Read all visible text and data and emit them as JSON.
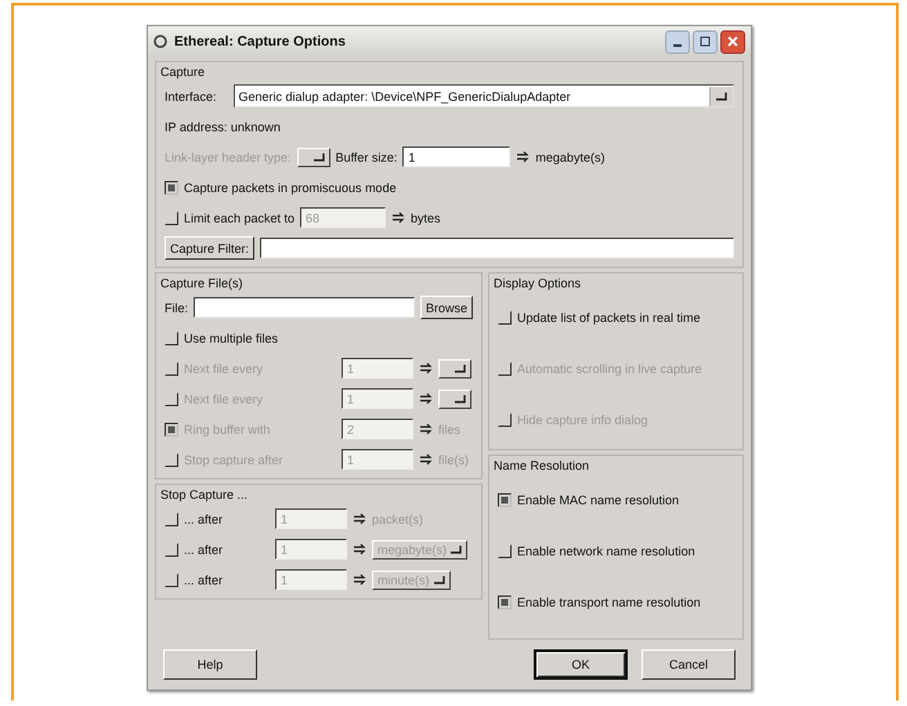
{
  "window": {
    "title": "Ethereal: Capture Options"
  },
  "capture": {
    "title": "Capture",
    "interface_label": "Interface:",
    "interface_value": "Generic dialup adapter: \\Device\\NPF_GenericDialupAdapter",
    "ip_address": "IP address: unknown",
    "link_layer_label": "Link-layer header type:",
    "link_layer_disabled": true,
    "buffer_label": "Buffer size:",
    "buffer_value": "1",
    "buffer_unit": "megabyte(s)",
    "promiscuous": {
      "label": "Capture packets in promiscuous mode",
      "checked": true
    },
    "limit": {
      "label": "Limit each packet to",
      "checked": false,
      "value": "68",
      "value_disabled": true,
      "unit": "bytes"
    },
    "filter_button": "Capture Filter:"
  },
  "capture_files": {
    "title": "Capture File(s)",
    "file_label": "File:",
    "browse_button": "Browse",
    "multiple_files": {
      "label": "Use multiple files",
      "checked": false
    },
    "rows": [
      {
        "kind": "dropdown",
        "label": "Next file every",
        "checked": false,
        "disabled": true,
        "value": "1"
      },
      {
        "kind": "dropdown",
        "label": "Next file every",
        "checked": false,
        "disabled": true,
        "value": "1"
      },
      {
        "kind": "unit",
        "label": "Ring buffer with",
        "checked": true,
        "disabled": true,
        "value": "2",
        "unit": "files"
      },
      {
        "kind": "unit",
        "label": "Stop capture after",
        "checked": false,
        "disabled": true,
        "value": "1",
        "unit": "file(s)"
      }
    ]
  },
  "stop_capture": {
    "title": "Stop Capture ...",
    "rows": [
      {
        "kind": "unit",
        "label": "... after",
        "checked": false,
        "field_disabled": true,
        "value": "1",
        "unit": "packet(s)"
      },
      {
        "kind": "dropdown",
        "label": "... after",
        "checked": false,
        "field_disabled": true,
        "value": "1",
        "option": "megabyte(s)"
      },
      {
        "kind": "dropdown",
        "label": "... after",
        "checked": false,
        "field_disabled": true,
        "value": "1",
        "option": "minute(s)"
      }
    ]
  },
  "display_options": {
    "title": "Display Options",
    "items": [
      {
        "label": "Update list of packets in real time",
        "checked": false,
        "disabled": false
      },
      {
        "label": "Automatic scrolling in live capture",
        "checked": false,
        "disabled": true
      },
      {
        "label": "Hide capture info dialog",
        "checked": false,
        "disabled": true
      }
    ]
  },
  "name_resolution": {
    "title": "Name Resolution",
    "items": [
      {
        "label": "Enable MAC name resolution",
        "checked": true
      },
      {
        "label": "Enable network name resolution",
        "checked": false
      },
      {
        "label": "Enable transport name resolution",
        "checked": true
      }
    ]
  },
  "buttons": [
    {
      "label": "Help",
      "default": false
    },
    {
      "label": "OK",
      "default": true
    },
    {
      "label": "Cancel",
      "default": false
    }
  ]
}
